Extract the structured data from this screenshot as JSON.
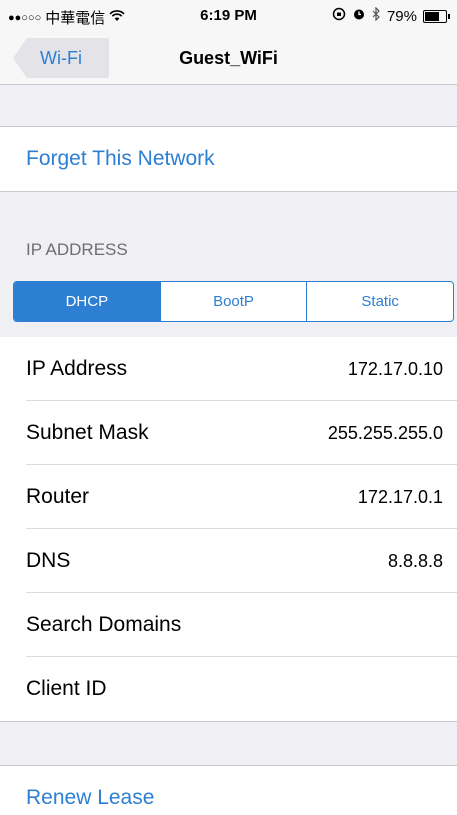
{
  "status_bar": {
    "signal": "●●○○○",
    "carrier": "中華電信",
    "wifi_icon": "wifi-icon",
    "time": "6:19 PM",
    "battery_percent": "79%",
    "battery_level": 0.79
  },
  "nav": {
    "back_label": "Wi-Fi",
    "title": "Guest_WiFi"
  },
  "forget_network": "Forget This Network",
  "ip_section": {
    "header": "IP ADDRESS",
    "segments": [
      "DHCP",
      "BootP",
      "Static"
    ],
    "selected_segment": "DHCP"
  },
  "rows": [
    {
      "label": "IP Address",
      "value": "172.17.0.10"
    },
    {
      "label": "Subnet Mask",
      "value": "255.255.255.0"
    },
    {
      "label": "Router",
      "value": "172.17.0.1"
    },
    {
      "label": "DNS",
      "value": "8.8.8.8"
    },
    {
      "label": "Search Domains",
      "value": ""
    },
    {
      "label": "Client ID",
      "value": ""
    }
  ],
  "renew_lease": "Renew Lease",
  "colors": {
    "accent": "#2c7fd3",
    "background": "#efeff4"
  }
}
